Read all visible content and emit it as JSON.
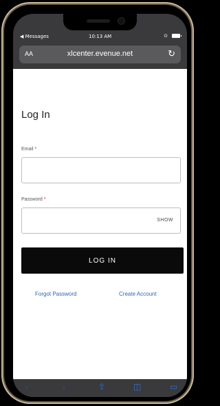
{
  "status_bar": {
    "back_label": "◀ Messages",
    "time": "10:13 AM"
  },
  "browser": {
    "aa_label": "AA",
    "url": "xlcenter.evenue.net"
  },
  "login": {
    "title": "Log In",
    "email_label": "Email",
    "password_label": "Password",
    "required_mark": "*",
    "show_label": "SHOW",
    "login_button": "LOG IN",
    "forgot_password": "Forgot Password",
    "create_account": "Create Account"
  },
  "toolbar": {
    "back_icon": "‹",
    "forward_icon": "›",
    "share_icon": "⇪",
    "bookmarks_icon": "◫",
    "tabs_icon": "▭"
  },
  "colors": {
    "link": "#2a68b8",
    "button_bg": "#0a0a0a",
    "required": "#c0262c"
  }
}
